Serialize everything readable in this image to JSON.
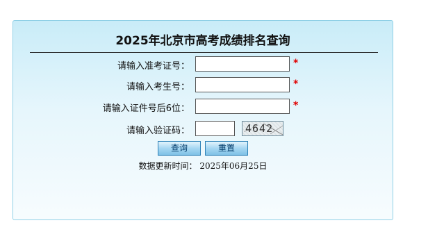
{
  "title": "2025年北京市高考成绩排名查询",
  "form": {
    "exam_id_label": "请输入准考证号：",
    "exam_id_value": "",
    "student_id_label": "请输入考生号：",
    "student_id_value": "",
    "id_last6_label": "请输入证件号后6位：",
    "id_last6_value": "",
    "captcha_label": "请输入验证码：",
    "captcha_value": "",
    "captcha_image_text": "4642",
    "required_mark": "*"
  },
  "buttons": {
    "query_label": "查询",
    "reset_label": "重置"
  },
  "update": {
    "label": "数据更新时间：",
    "date": "2025年06月25日"
  },
  "colors": {
    "required": "#e00000",
    "panel_border": "#8fd0e6",
    "button_border": "#2e82b7"
  }
}
